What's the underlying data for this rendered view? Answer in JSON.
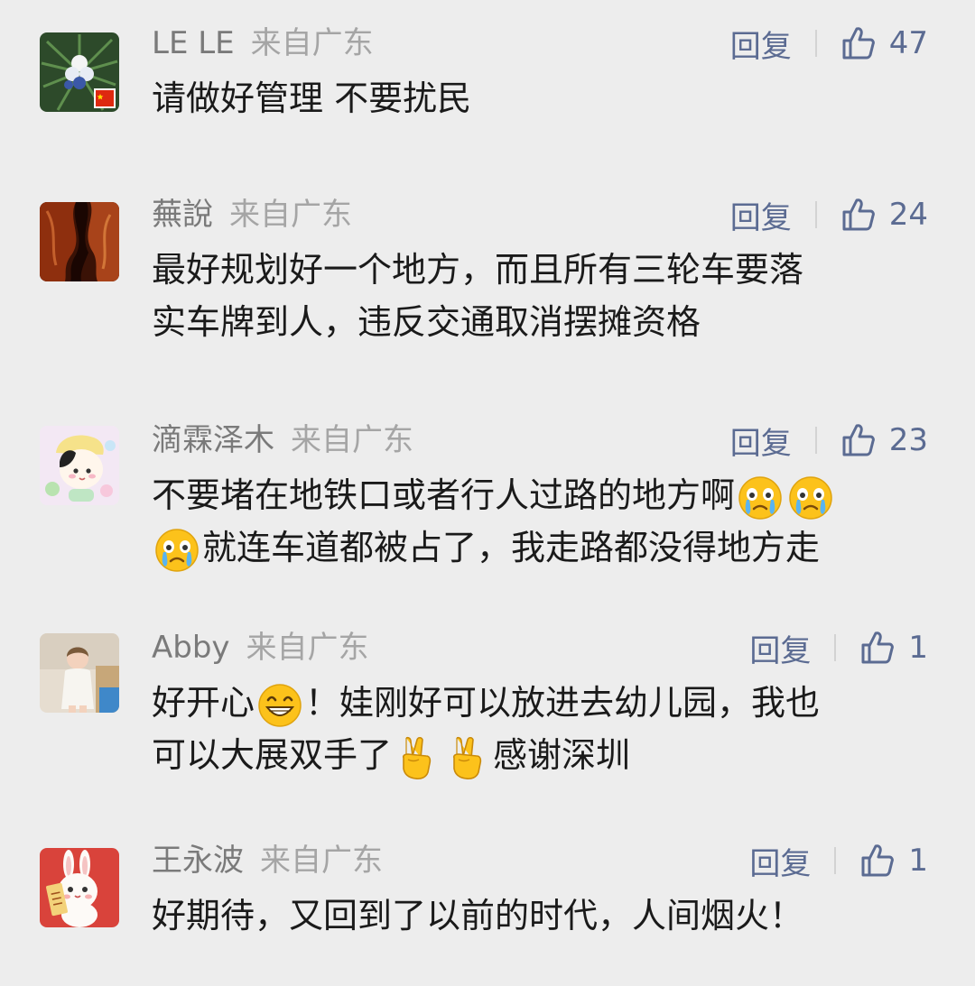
{
  "comments": [
    {
      "username": "LE LE",
      "location": "来自广东",
      "reply_label": "回复",
      "likes": "47",
      "text": "请做好管理 不要扰民"
    },
    {
      "username": "蕪說",
      "location": "来自广东",
      "reply_label": "回复",
      "likes": "24",
      "line1": "最好规划好一个地方，而且所有三轮车要落",
      "line2": "实车牌到人，违反交通取消摆摊资格"
    },
    {
      "username": "滴霖泽木",
      "location": "来自广东",
      "reply_label": "回复",
      "likes": "23",
      "text_a": "不要堵在地铁口或者行人过路的地方啊",
      "text_b": "就连车道都被占了，我走路都没得地方走"
    },
    {
      "username": "Abby",
      "location": "来自广东",
      "reply_label": "回复",
      "likes": "1",
      "text_a": "好开心",
      "text_b": "！娃刚好可以放进去幼儿园，我也",
      "text_c": "可以大展双手了",
      "text_d": "感谢深圳"
    },
    {
      "username": "王永波",
      "location": "来自广东",
      "reply_label": "回复",
      "likes": "1",
      "text": "好期待，又回到了以前的时代，人间烟火！"
    }
  ],
  "icons": {
    "like": "thumbs-up-icon",
    "flag": "china-flag-icon",
    "crying_emoji": "crying-face-emoji",
    "grin_emoji": "grinning-face-emoji",
    "victory_emoji": "victory-hand-emoji"
  },
  "colors": {
    "background": "#ededed",
    "username": "#7a7a7a",
    "location": "#a5a5a5",
    "action": "#5b6b92",
    "text": "#1a1a1a"
  }
}
